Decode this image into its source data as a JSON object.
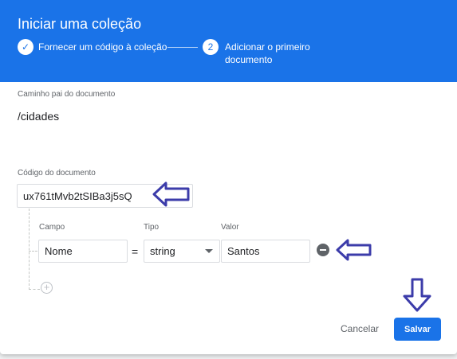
{
  "dialog": {
    "title": "Iniciar uma coleção",
    "steps": [
      {
        "marker": "✓",
        "label": "Fornecer um código à coleção"
      },
      {
        "marker": "2",
        "label_line1": "Adicionar o primeiro",
        "label_line2": "documento"
      }
    ]
  },
  "parent_path": {
    "label": "Caminho pai do documento",
    "value": "/cidades"
  },
  "document_id": {
    "label": "Código do documento",
    "value": "ux761tMvb2tSIBa3j5sQ"
  },
  "fields": {
    "headers": {
      "field": "Campo",
      "type": "Tipo",
      "value": "Valor"
    },
    "rows": [
      {
        "name": "Nome",
        "operator": "=",
        "type": "string",
        "value": "Santos"
      }
    ],
    "add_icon": "plus-circle-icon",
    "remove_icon": "minus-circle-icon"
  },
  "actions": {
    "cancel": "Cancelar",
    "save": "Salvar"
  },
  "colors": {
    "header": "#1a73e8",
    "annotation_arrows": "#3c3caa"
  }
}
